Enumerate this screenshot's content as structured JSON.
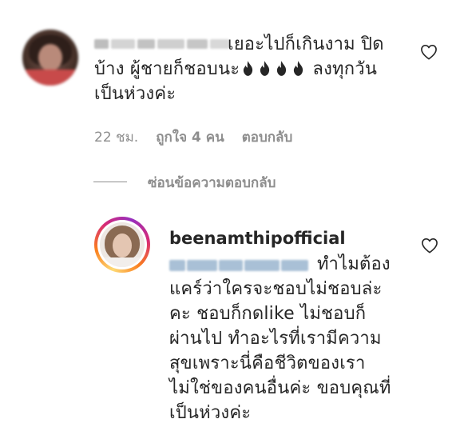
{
  "comment": {
    "lines": [
      "เยอะไปก็เกินงาม ปิด",
      "บ้าง ผู้ชายก็ชอบนะ",
      "ลงทุกวัน",
      "เป็นห่วงค่ะ"
    ],
    "emoji_icon": "fire-emoji",
    "emoji_count": 4,
    "time": "22 ชม.",
    "likes": "ถูกใจ 4 คน",
    "reply": "ตอบกลับ"
  },
  "hide_replies": "ซ่อนข้อความตอบกลับ",
  "reply": {
    "username": "beenamthipofficial",
    "lines": [
      "ทำไมต้อง",
      "แคร์ว่าใครจะชอบไม่ชอบล่ะ",
      "คะ ชอบก็กดlike ไม่ชอบก็",
      "ผ่านไป ทำอะไรที่เรามีความ",
      "สุขเพราะนี่คือชีวิตของเรา",
      "ไม่ใช่ของคนอื่นค่ะ ขอบคุณที่",
      "เป็นห่วงค่ะ"
    ]
  },
  "colors": {
    "text": "#262626",
    "secondary": "#8e8e8e",
    "mention_blur": "#a9c0d6",
    "story_ring": [
      "#feda75",
      "#fa7e1e",
      "#d62976",
      "#962fbf"
    ]
  }
}
